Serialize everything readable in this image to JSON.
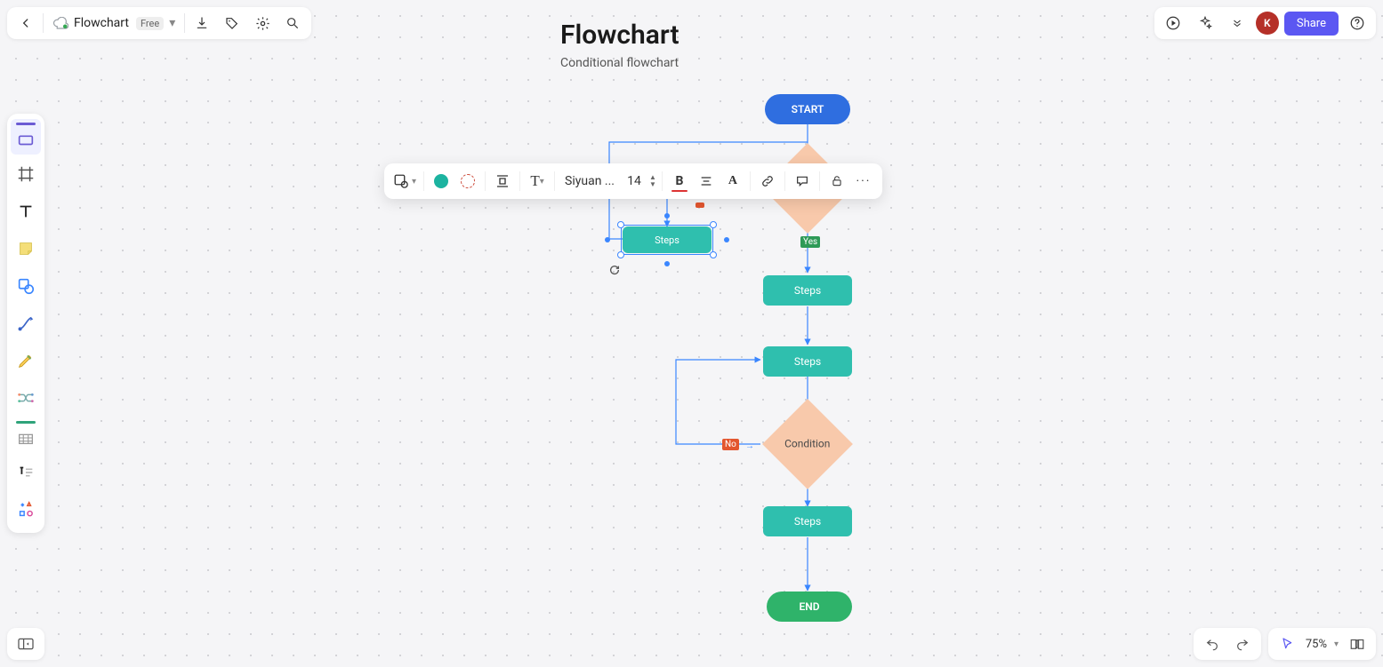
{
  "header": {
    "doc_name": "Flowchart",
    "plan_badge": "Free",
    "share_label": "Share",
    "avatar_initial": "K"
  },
  "title": {
    "main": "Flowchart",
    "sub": "Conditional flowchart"
  },
  "format_bar": {
    "font_name": "Siyuan ...",
    "font_size": "14",
    "fill_color": "#1cb3a0"
  },
  "zoom": {
    "value": "75%"
  },
  "flow": {
    "start": "START",
    "end": "END",
    "steps_selected": "Steps",
    "steps2": "Steps",
    "steps3": "Steps",
    "steps4": "Steps",
    "condition": "Condition",
    "yes": "Yes",
    "no": "No"
  },
  "colors": {
    "start": "#2f6ee0",
    "end": "#2fb36a",
    "step": "#2fbfae",
    "diamond": "#f8c9ab",
    "yes": "#2e9a57",
    "no": "#e3562f",
    "connector": "#3a86ff"
  }
}
